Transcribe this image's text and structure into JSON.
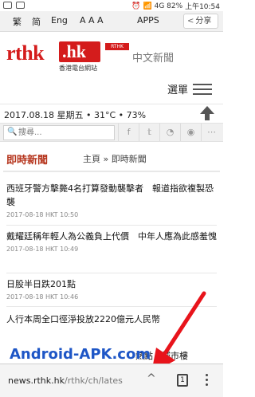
{
  "status_bar": {
    "battery": "82%",
    "time": "上午10:54",
    "network": "4G"
  },
  "lang_bar": {
    "items": [
      "繁",
      "简",
      "Eng"
    ],
    "font_sizes": "A A A",
    "apps": "APPS",
    "share": "分享"
  },
  "header": {
    "logo_main": "rthk",
    "logo_hk": ".hk",
    "logo_sub": "香港電台網站",
    "logo_badge": "RTHK",
    "site_name": "中文新聞"
  },
  "menu": {
    "label": "選單"
  },
  "info": {
    "date_weather": "2017.08.18 星期五 • 31°C • 73%"
  },
  "search": {
    "placeholder": "搜尋..."
  },
  "section": {
    "title": "即時新聞",
    "breadcrumb_home": "主頁",
    "breadcrumb_sep": "»",
    "breadcrumb_current": "即時新聞"
  },
  "news": [
    {
      "title": "西班牙警方擊斃4名打算發動襲擊者　報道指欲複製恐襲",
      "time": "2017-08-18 HKT 10:50"
    },
    {
      "title": "戴耀廷稱年輕人為公義負上代價　中年人應為此感羞愧",
      "time": "2017-08-18 HKT 10:49"
    },
    {
      "title": "日股半日跌201點",
      "time": "2017-08-18 HKT 10:46"
    },
    {
      "title": "人行本周全口徑淨投放2220億元人民幣",
      "time": ""
    },
    {
      "title": "熱點　城市樓",
      "time": ""
    }
  ],
  "watermark": "Android-APK.com",
  "browser": {
    "url_domain": "news.rthk.hk",
    "url_path": "/rthk/ch/lates",
    "tab_count": "1"
  }
}
